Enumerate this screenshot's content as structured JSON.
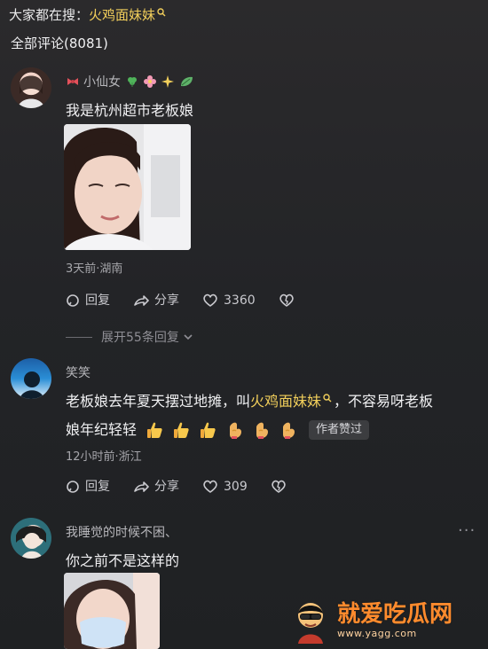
{
  "search": {
    "prefix": "大家都在搜：",
    "term": "火鸡面妹妹"
  },
  "comments_header": {
    "label": "全部评论(8081)"
  },
  "comments": [
    {
      "username": "小仙女",
      "text": "我是杭州超市老板娘",
      "meta": "3天前·湖南",
      "actions": {
        "reply": "回复",
        "share": "分享",
        "likes": "3360"
      }
    },
    {
      "username": "笑笑",
      "text_part1": "老板娘去年夏天摆过地摊，叫",
      "highlight": "火鸡面妹妹",
      "text_part2": "，不容易呀老板",
      "text_line2": "娘年纪轻轻",
      "badge": "作者赞过",
      "meta": "12小时前·浙江",
      "actions": {
        "reply": "回复",
        "share": "分享",
        "likes": "309"
      }
    },
    {
      "username": "我睡觉的时候不困、",
      "text": "你之前不是这样的",
      "more": "···"
    }
  ],
  "replies_toggle": {
    "label": "展开55条回复"
  },
  "watermark": {
    "text": "就爱吃瓜网",
    "url": "www.yagg.com"
  },
  "colors": {
    "highlight": "#f2cf5b",
    "text": "#f0f0f2",
    "meta": "#a6a6ab"
  }
}
